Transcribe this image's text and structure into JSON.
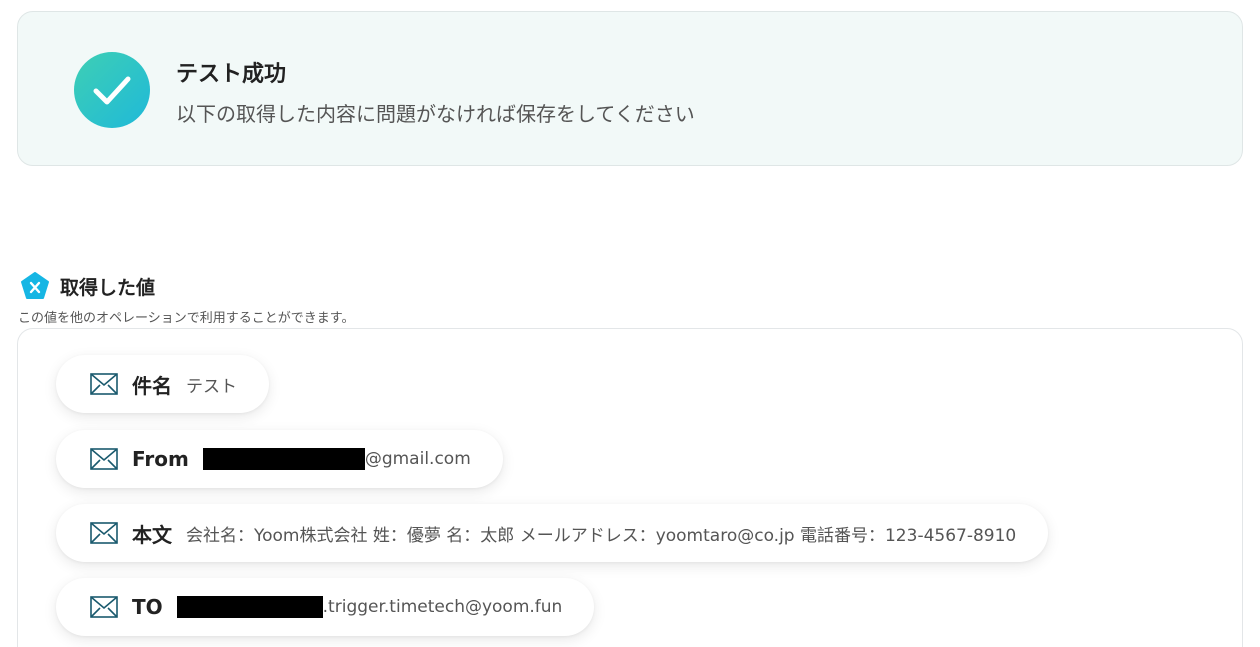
{
  "banner": {
    "title": "テスト成功",
    "message": "以下の取得した内容に問題がなければ保存をしてください",
    "accent_color": "#2ec4c6",
    "icon": "check-icon"
  },
  "values_section": {
    "title": "取得した値",
    "subtitle": "この値を他のオペレーションで利用することができます。",
    "icon": "variable-icon"
  },
  "values": {
    "subject": {
      "key": "件名",
      "value": "テスト",
      "icon": "mail-icon"
    },
    "from": {
      "key": "From",
      "value": "@gmail.com",
      "icon": "mail-icon",
      "redacted": true
    },
    "body": {
      "key": "本文",
      "value": "会社名：Yoom株式会社 姓：優夢 名：太郎 メールアドレス：yoomtaro@co.jp 電話番号：123-4567-8910",
      "icon": "mail-icon"
    },
    "to": {
      "key": "TO",
      "value": ".trigger.timetech@yoom.fun",
      "icon": "mail-icon",
      "redacted": true
    }
  }
}
